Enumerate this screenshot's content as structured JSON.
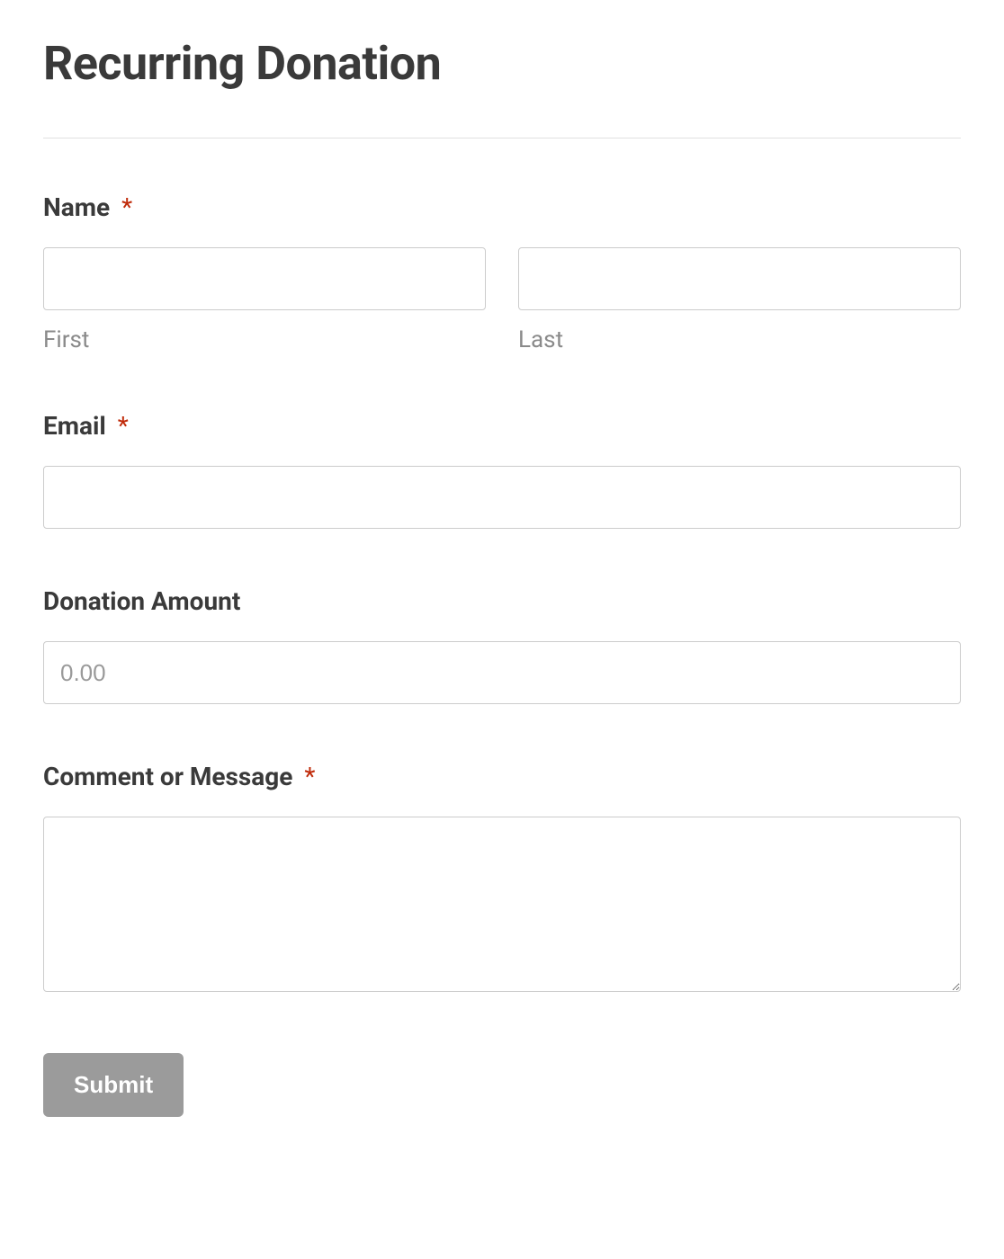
{
  "page": {
    "title": "Recurring Donation"
  },
  "form": {
    "name": {
      "label": "Name",
      "required_mark": "*",
      "first_sublabel": "First",
      "last_sublabel": "Last",
      "first_value": "",
      "last_value": ""
    },
    "email": {
      "label": "Email",
      "required_mark": "*",
      "value": ""
    },
    "donation": {
      "label": "Donation Amount",
      "placeholder": "0.00",
      "value": ""
    },
    "comment": {
      "label": "Comment or Message",
      "required_mark": "*",
      "value": ""
    },
    "submit_label": "Submit"
  }
}
